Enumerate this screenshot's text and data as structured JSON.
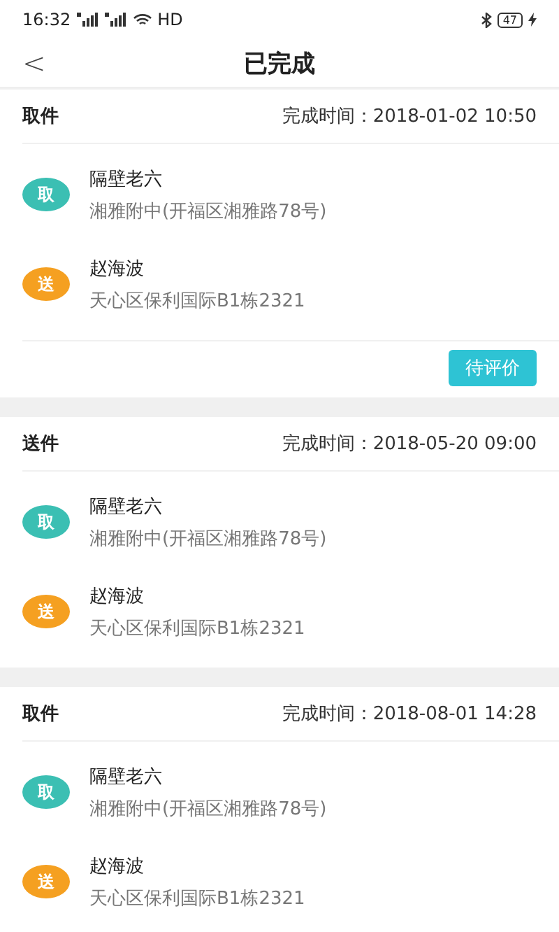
{
  "status_bar": {
    "time": "16:32",
    "network": "HD",
    "battery": "47"
  },
  "nav": {
    "back": "<",
    "title": "已完成"
  },
  "orders": [
    {
      "type": "取件",
      "time_label": "完成时间：",
      "time": "2018-01-02 10:50",
      "stops": [
        {
          "kind": "pickup",
          "badge": "取",
          "name": "隔壁老六",
          "address": "湘雅附中(开福区湘雅路78号)"
        },
        {
          "kind": "deliver",
          "badge": "送",
          "name": "赵海波",
          "address": "天心区保利国际B1栋2321"
        }
      ],
      "action": "待评价"
    },
    {
      "type": "送件",
      "time_label": "完成时间：",
      "time": "2018-05-20 09:00",
      "stops": [
        {
          "kind": "pickup",
          "badge": "取",
          "name": "隔壁老六",
          "address": "湘雅附中(开福区湘雅路78号)"
        },
        {
          "kind": "deliver",
          "badge": "送",
          "name": "赵海波",
          "address": "天心区保利国际B1栋2321"
        }
      ]
    },
    {
      "type": "取件",
      "time_label": "完成时间：",
      "time": "2018-08-01 14:28",
      "stops": [
        {
          "kind": "pickup",
          "badge": "取",
          "name": "隔壁老六",
          "address": "湘雅附中(开福区湘雅路78号)"
        },
        {
          "kind": "deliver",
          "badge": "送",
          "name": "赵海波",
          "address": "天心区保利国际B1栋2321"
        }
      ]
    }
  ]
}
